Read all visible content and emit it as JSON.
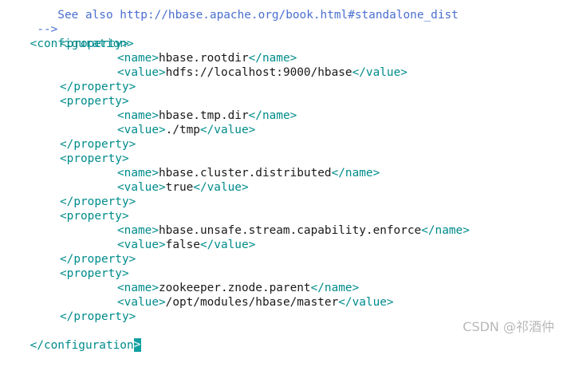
{
  "header_comment": {
    "partial_line": "    See also http://hbase.apache.org/book.html#standalone_dist",
    "close": " -->"
  },
  "configuration": {
    "open_tag": "<configuration>",
    "close_tag_text": "</configuration",
    "close_tag_end": ">"
  },
  "tags": {
    "property_open": "<property>",
    "property_close": "</property>",
    "name_open": "<name>",
    "name_close": "</name>",
    "value_open": "<value>",
    "value_close": "</value>"
  },
  "properties": [
    {
      "name": "hbase.rootdir",
      "value": "hdfs://localhost:9000/hbase"
    },
    {
      "name": "hbase.tmp.dir",
      "value": "./tmp"
    },
    {
      "name": "hbase.cluster.distributed",
      "value": "true"
    },
    {
      "name": "hbase.unsafe.stream.capability.enforce",
      "value": "false"
    },
    {
      "name": "zookeeper.znode.parent",
      "value": "/opt/modules/hbase/master"
    }
  ],
  "watermark": "CSDN @祁酒仲",
  "colors": {
    "tag": "#008b8b",
    "text": "#1a1a1a",
    "comment": "#4a6fd0",
    "cursor": "#11a0a0"
  }
}
